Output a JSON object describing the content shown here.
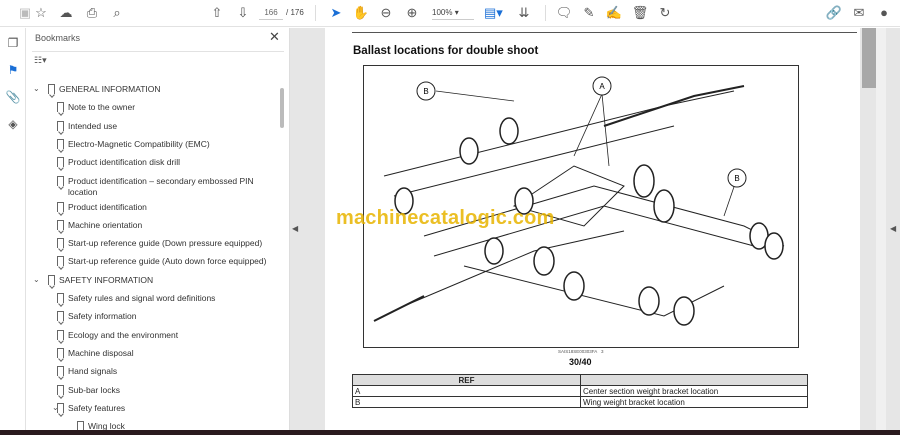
{
  "toolbar": {
    "page_current": "166",
    "page_total": "/ 176",
    "zoom": "100%"
  },
  "bookmarks": {
    "title": "Bookmarks",
    "close": "✕",
    "items": [
      {
        "label": "GENERAL INFORMATION",
        "level": 0,
        "expanded": true
      },
      {
        "label": "Note to the owner",
        "level": 1
      },
      {
        "label": "Intended use",
        "level": 1
      },
      {
        "label": "Electro-Magnetic Compatibility (EMC)",
        "level": 1
      },
      {
        "label": "Product identification disk drill",
        "level": 1
      },
      {
        "label": "Product identification  – secondary embossed PIN",
        "label2": "location",
        "level": 1
      },
      {
        "label": "Product identification",
        "level": 1
      },
      {
        "label": "Machine orientation",
        "level": 1
      },
      {
        "label": "Start-up reference guide (Down pressure equipped)",
        "level": 1
      },
      {
        "label": "Start-up reference guide (Auto down force equipped)",
        "level": 1
      },
      {
        "label": "SAFETY INFORMATION",
        "level": 0,
        "expanded": true
      },
      {
        "label": "Safety rules and signal word definitions",
        "level": 1
      },
      {
        "label": "Safety information",
        "level": 1
      },
      {
        "label": "Ecology and the environment",
        "level": 1
      },
      {
        "label": "Machine disposal",
        "level": 1
      },
      {
        "label": "Hand signals",
        "level": 1
      },
      {
        "label": "Sub-bar locks",
        "level": 1
      },
      {
        "label": "Safety features",
        "level": 1,
        "expanded": true
      },
      {
        "label": "Wing lock",
        "level": 2
      }
    ]
  },
  "document": {
    "heading": "Ballast locations for double shoot",
    "callouts": [
      "A",
      "B",
      "B"
    ],
    "figure_code": "SAIS18SE00303FA",
    "figure_index": "3",
    "figure_number": "30/40",
    "watermark": "machinecatalogic.com",
    "table": {
      "header": [
        "REF",
        ""
      ],
      "rows": [
        [
          "A",
          "Center section weight bracket location"
        ],
        [
          "B",
          "Wing weight bracket location"
        ]
      ]
    }
  }
}
